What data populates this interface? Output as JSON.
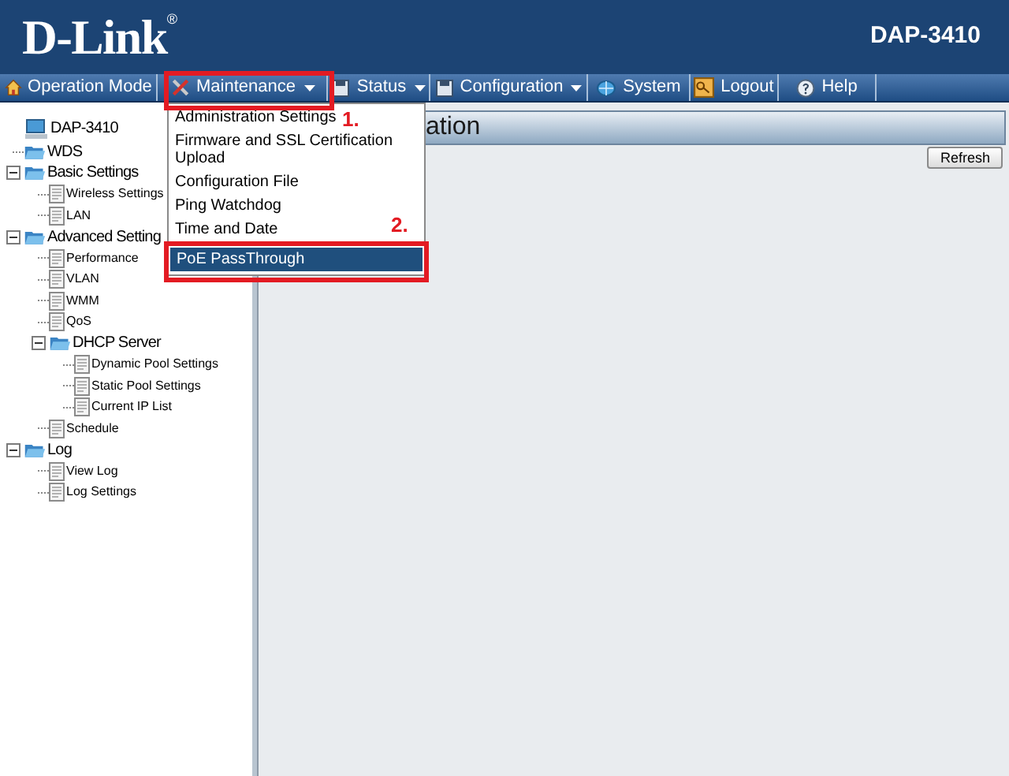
{
  "header": {
    "logo": "D-Link",
    "trademark": "®",
    "model": "DAP-3410"
  },
  "nav": [
    {
      "label": "Operation Mode",
      "caret": false
    },
    {
      "label": "Maintenance",
      "caret": true
    },
    {
      "label": "Status",
      "caret": true
    },
    {
      "label": "Configuration",
      "caret": true
    },
    {
      "label": "System",
      "caret": false
    },
    {
      "label": "Logout",
      "caret": false
    },
    {
      "label": "Help",
      "caret": false
    }
  ],
  "dropdown": [
    {
      "label": "Administration Settings",
      "selected": false
    },
    {
      "label": "Firmware and SSL Certification Upload",
      "selected": false
    },
    {
      "label": "Configuration File",
      "selected": false
    },
    {
      "label": "Ping Watchdog",
      "selected": false
    },
    {
      "label": "Time and Date",
      "selected": false
    },
    {
      "label": "PoE PassThrough",
      "selected": true
    }
  ],
  "annotations": [
    {
      "label": "1."
    },
    {
      "label": "2."
    }
  ],
  "tree": [
    {
      "label": "DAP-3410",
      "kind": "computer",
      "children": [
        {
          "label": "WDS",
          "kind": "folder"
        },
        {
          "label": "Basic Settings",
          "kind": "folder",
          "expanded": true,
          "children": [
            {
              "label": "Wireless Settings",
              "kind": "page"
            },
            {
              "label": "LAN",
              "kind": "page"
            }
          ]
        },
        {
          "label": "Advanced Setting",
          "kind": "folder",
          "expanded": true,
          "children": [
            {
              "label": "Performance",
              "kind": "page"
            },
            {
              "label": "VLAN",
              "kind": "page"
            },
            {
              "label": "WMM",
              "kind": "page"
            },
            {
              "label": "QoS",
              "kind": "page"
            },
            {
              "label": "DHCP Server",
              "kind": "folder",
              "expanded": true,
              "children": [
                {
                  "label": "Dynamic Pool Settings",
                  "kind": "page"
                },
                {
                  "label": "Static Pool Settings",
                  "kind": "page"
                },
                {
                  "label": "Current IP List",
                  "kind": "page"
                }
              ]
            },
            {
              "label": "Schedule",
              "kind": "page"
            }
          ]
        },
        {
          "label": "Log",
          "kind": "folder",
          "expanded": true,
          "children": [
            {
              "label": "View Log",
              "kind": "page"
            },
            {
              "label": "Log Settings",
              "kind": "page"
            }
          ]
        }
      ]
    }
  ],
  "panel": {
    "title": "ation",
    "refresh": "Refresh"
  }
}
